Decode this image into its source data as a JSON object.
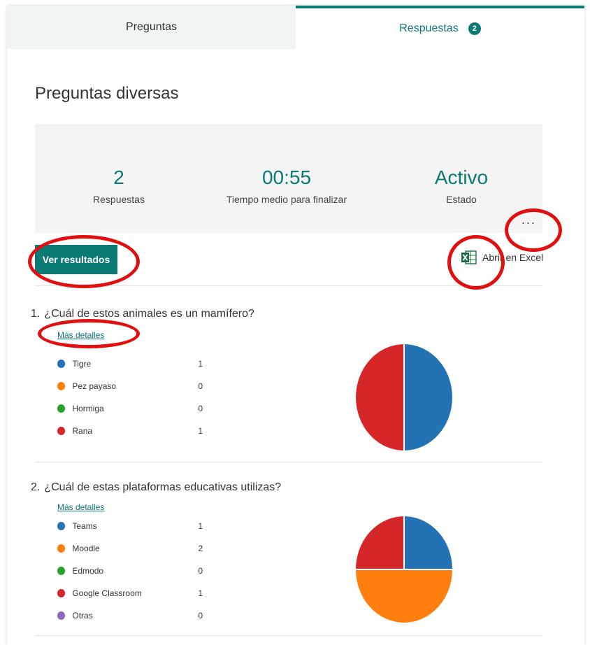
{
  "tabs": {
    "preguntas_label": "Preguntas",
    "respuestas_label": "Respuestas",
    "respuestas_badge": "2"
  },
  "form": {
    "title": "Preguntas diversas"
  },
  "stats": {
    "responses_value": "2",
    "responses_label": "Respuestas",
    "avg_time_value": "00:55",
    "avg_time_label": "Tiempo medio para finalizar",
    "status_value": "Activo",
    "status_label": "Estado",
    "more_label": "..."
  },
  "actions": {
    "view_results_label": "Ver resultados",
    "open_excel_label": "Abrir en Excel"
  },
  "questions": [
    {
      "number": "1.",
      "text": "¿Cuál de estos animales es un mamífero?",
      "details_label": "Más detalles",
      "options": [
        {
          "label": "Tigre",
          "count": "1",
          "color": "#2272b4"
        },
        {
          "label": "Pez payaso",
          "count": "0",
          "color": "#ff7f0e"
        },
        {
          "label": "Hormiga",
          "count": "0",
          "color": "#2ca02c"
        },
        {
          "label": "Rana",
          "count": "1",
          "color": "#d62728"
        }
      ]
    },
    {
      "number": "2.",
      "text": "¿Cuál de estas plataformas educativas utilizas?",
      "details_label": "Más detalles",
      "options": [
        {
          "label": "Teams",
          "count": "1",
          "color": "#2272b4"
        },
        {
          "label": "Moodle",
          "count": "2",
          "color": "#ff7f0e"
        },
        {
          "label": "Edmodo",
          "count": "0",
          "color": "#2ca02c"
        },
        {
          "label": "Google Classroom",
          "count": "1",
          "color": "#d62728"
        },
        {
          "label": "Otras",
          "count": "0",
          "color": "#9467bd"
        }
      ]
    }
  ],
  "chart_data": [
    {
      "type": "pie",
      "categories": [
        "Tigre",
        "Pez payaso",
        "Hormiga",
        "Rana"
      ],
      "values": [
        1,
        0,
        0,
        1
      ],
      "colors": [
        "#2272b4",
        "#ff7f0e",
        "#2ca02c",
        "#d62728"
      ]
    },
    {
      "type": "pie",
      "categories": [
        "Teams",
        "Moodle",
        "Edmodo",
        "Google Classroom",
        "Otras"
      ],
      "values": [
        1,
        2,
        0,
        1,
        0
      ],
      "colors": [
        "#2272b4",
        "#ff7f0e",
        "#2ca02c",
        "#d62728",
        "#9467bd"
      ]
    }
  ],
  "colors": {
    "accent": "#0b7a75",
    "annotation": "#e01010"
  }
}
